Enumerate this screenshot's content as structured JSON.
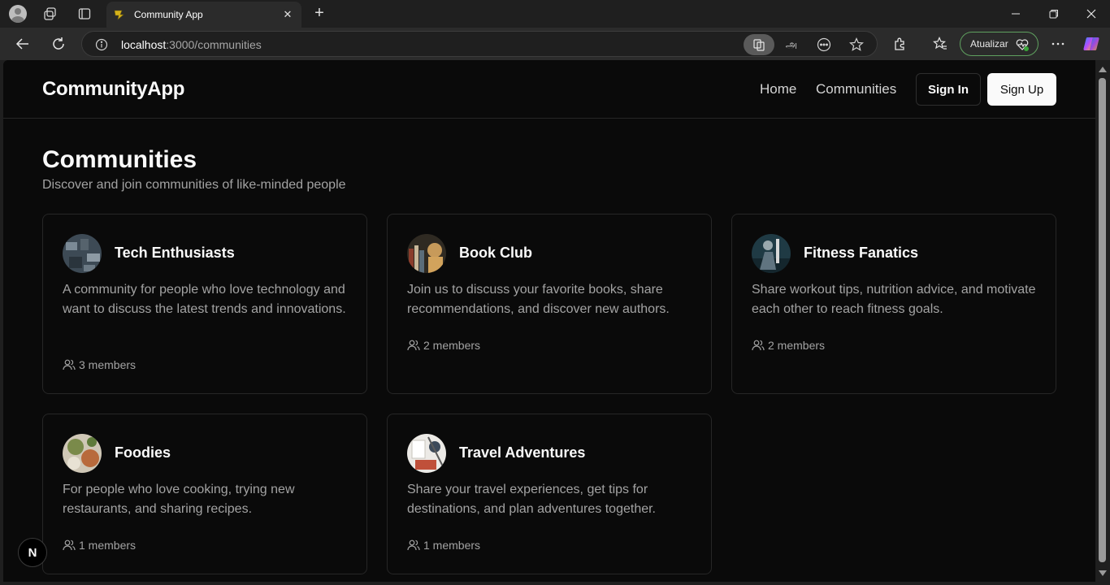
{
  "browser": {
    "tab_title": "Community App",
    "url_host": "localhost",
    "url_rest": ":3000/communities",
    "update_label": "Atualizar",
    "translate_glyph": "அ"
  },
  "nav": {
    "brand": "CommunityApp",
    "home": "Home",
    "communities": "Communities",
    "sign_in": "Sign In",
    "sign_up": "Sign Up"
  },
  "page": {
    "title": "Communities",
    "subtitle": "Discover and join communities of like-minded people"
  },
  "communities": [
    {
      "name": "Tech Enthusiasts",
      "description": "A community for people who love technology and want to discuss the latest trends and innovations.",
      "members": "3 members"
    },
    {
      "name": "Book Club",
      "description": "Join us to discuss your favorite books, share recommendations, and discover new authors.",
      "members": "2 members"
    },
    {
      "name": "Fitness Fanatics",
      "description": "Share workout tips, nutrition advice, and motivate each other to reach fitness goals.",
      "members": "2 members"
    },
    {
      "name": "Foodies",
      "description": "For people who love cooking, trying new restaurants, and sharing recipes.",
      "members": "1 members"
    },
    {
      "name": "Travel Adventures",
      "description": "Share your travel experiences, get tips for destinations, and plan adventures together.",
      "members": "1 members"
    }
  ],
  "dev_badge": "N",
  "colors": {
    "page_bg": "#0a0a0a",
    "border": "#262626",
    "text": "#fafafa",
    "muted": "#a3a3a3"
  }
}
